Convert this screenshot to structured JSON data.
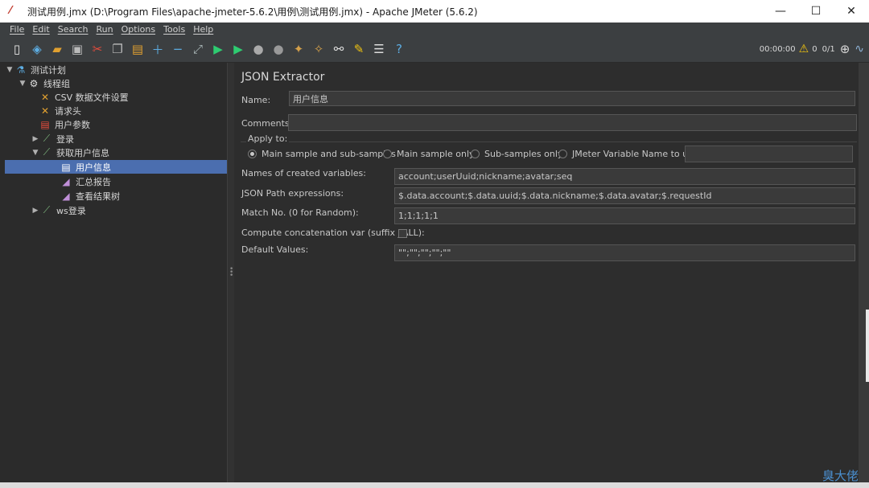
{
  "window": {
    "title": "测试用例.jmx (D:\\Program Files\\apache-jmeter-5.6.2\\用例\\测试用例.jmx) - Apache JMeter (5.6.2)",
    "minimize": "—",
    "maximize": "☐",
    "close": "✕"
  },
  "menu": [
    "File",
    "Edit",
    "Search",
    "Run",
    "Options",
    "Tools",
    "Help"
  ],
  "status": {
    "timer": "00:00:00",
    "warnings": "0",
    "threads": "0/1"
  },
  "tree": {
    "nodes": [
      {
        "label": "测试计划"
      },
      {
        "label": "线程组"
      },
      {
        "label": "CSV 数据文件设置"
      },
      {
        "label": "请求头"
      },
      {
        "label": "用户参数"
      },
      {
        "label": "登录"
      },
      {
        "label": "获取用户信息"
      },
      {
        "label": "用户信息"
      },
      {
        "label": "汇总报告"
      },
      {
        "label": "查看结果树"
      },
      {
        "label": "ws登录"
      }
    ]
  },
  "extractor": {
    "panel_title": "JSON Extractor",
    "name_label": "Name:",
    "name_value": "用户信息",
    "comments_label": "Comments:",
    "comments_value": "",
    "apply_to_label": "Apply to:",
    "apply_options": [
      "Main sample and sub-samples",
      "Main sample only",
      "Sub-samples only",
      "JMeter Variable Name to use"
    ],
    "variable_name_value": "",
    "var_names_label": "Names of created variables:",
    "var_names_value": "account;userUuid;nickname;avatar;seq",
    "json_path_label": "JSON Path expressions:",
    "json_path_value": "$.data.account;$.data.uuid;$.data.nickname;$.data.avatar;$.requestId",
    "match_no_label": "Match No. (0 for Random):",
    "match_no_value": "1;1;1;1;1",
    "concat_label": "Compute concatenation var (suffix _ALL):",
    "default_label": "Default Values:",
    "default_value": "\"\";\"\";\"\";\"\";\"\""
  },
  "watermark": "臭大佬"
}
